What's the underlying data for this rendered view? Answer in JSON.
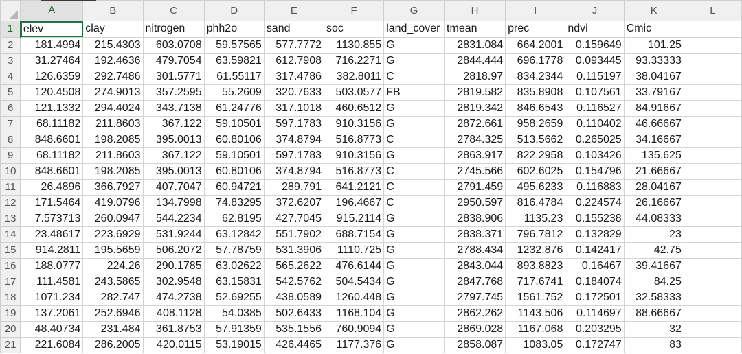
{
  "columns": [
    "A",
    "B",
    "C",
    "D",
    "E",
    "F",
    "G",
    "H",
    "I",
    "J",
    "K",
    "L"
  ],
  "rows": [
    {
      "n": "1",
      "cells": [
        "elev",
        "clay",
        "nitrogen",
        "phh2o",
        "sand",
        "soc",
        "land_cover",
        "tmean",
        "prec",
        "ndvi",
        "Cmic",
        ""
      ]
    },
    {
      "n": "2",
      "cells": [
        "181.4994",
        "215.4303",
        "603.0708",
        "59.57565",
        "577.7772",
        "1130.855",
        "G",
        "2831.084",
        "664.2001",
        "0.159649",
        "101.25",
        ""
      ]
    },
    {
      "n": "3",
      "cells": [
        "31.27464",
        "192.4636",
        "479.7054",
        "63.59821",
        "612.7908",
        "716.2271",
        "G",
        "2844.444",
        "696.1778",
        "0.093445",
        "93.33333",
        ""
      ]
    },
    {
      "n": "4",
      "cells": [
        "126.6359",
        "292.7486",
        "301.5771",
        "61.55117",
        "317.4786",
        "382.8011",
        "C",
        "2818.97",
        "834.2344",
        "0.115197",
        "38.04167",
        ""
      ]
    },
    {
      "n": "5",
      "cells": [
        "120.4508",
        "274.9013",
        "357.2595",
        "55.2609",
        "320.7633",
        "503.0577",
        "FB",
        "2819.582",
        "835.8908",
        "0.107561",
        "33.79167",
        ""
      ]
    },
    {
      "n": "6",
      "cells": [
        "121.1332",
        "294.4024",
        "343.7138",
        "61.24776",
        "317.1018",
        "460.6512",
        "G",
        "2819.342",
        "846.6543",
        "0.116527",
        "84.91667",
        ""
      ]
    },
    {
      "n": "7",
      "cells": [
        "68.11182",
        "211.8603",
        "367.122",
        "59.10501",
        "597.1783",
        "910.3156",
        "G",
        "2872.661",
        "958.2659",
        "0.110402",
        "46.66667",
        ""
      ]
    },
    {
      "n": "8",
      "cells": [
        "848.6601",
        "198.2085",
        "395.0013",
        "60.80106",
        "374.8794",
        "516.8773",
        "C",
        "2784.325",
        "513.5662",
        "0.265025",
        "34.16667",
        ""
      ]
    },
    {
      "n": "9",
      "cells": [
        "68.11182",
        "211.8603",
        "367.122",
        "59.10501",
        "597.1783",
        "910.3156",
        "G",
        "2863.917",
        "822.2958",
        "0.103426",
        "135.625",
        ""
      ]
    },
    {
      "n": "10",
      "cells": [
        "848.6601",
        "198.2085",
        "395.0013",
        "60.80106",
        "374.8794",
        "516.8773",
        "C",
        "2745.566",
        "602.6025",
        "0.154796",
        "21.66667",
        ""
      ]
    },
    {
      "n": "11",
      "cells": [
        "26.4896",
        "366.7927",
        "407.7047",
        "60.94721",
        "289.791",
        "641.2121",
        "C",
        "2791.459",
        "495.6233",
        "0.116883",
        "28.04167",
        ""
      ]
    },
    {
      "n": "12",
      "cells": [
        "171.5464",
        "419.0796",
        "134.7998",
        "74.83295",
        "372.6207",
        "196.4667",
        "C",
        "2950.597",
        "816.4784",
        "0.224574",
        "26.16667",
        ""
      ]
    },
    {
      "n": "13",
      "cells": [
        "7.573713",
        "260.0947",
        "544.2234",
        "62.8195",
        "427.7045",
        "915.2114",
        "G",
        "2838.906",
        "1135.23",
        "0.155238",
        "44.08333",
        ""
      ]
    },
    {
      "n": "14",
      "cells": [
        "23.48617",
        "223.6929",
        "531.9244",
        "63.12842",
        "551.7902",
        "688.7154",
        "G",
        "2838.371",
        "796.7812",
        "0.132829",
        "23",
        ""
      ]
    },
    {
      "n": "15",
      "cells": [
        "914.2811",
        "195.5659",
        "506.2072",
        "57.78759",
        "531.3906",
        "1110.725",
        "G",
        "2788.434",
        "1232.876",
        "0.142417",
        "42.75",
        ""
      ]
    },
    {
      "n": "16",
      "cells": [
        "188.0777",
        "224.26",
        "290.1785",
        "63.02622",
        "565.2622",
        "476.6144",
        "G",
        "2843.044",
        "893.8823",
        "0.16467",
        "39.41667",
        ""
      ]
    },
    {
      "n": "17",
      "cells": [
        "111.4581",
        "243.5865",
        "302.9548",
        "63.15831",
        "542.5762",
        "504.5434",
        "G",
        "2847.768",
        "717.6741",
        "0.184074",
        "84.25",
        ""
      ]
    },
    {
      "n": "18",
      "cells": [
        "1071.234",
        "282.747",
        "474.2738",
        "52.69255",
        "438.0589",
        "1260.448",
        "G",
        "2797.745",
        "1561.752",
        "0.172501",
        "32.58333",
        ""
      ]
    },
    {
      "n": "19",
      "cells": [
        "137.2061",
        "252.6946",
        "408.1128",
        "54.0385",
        "502.6433",
        "1168.104",
        "G",
        "2862.262",
        "1143.506",
        "0.114697",
        "88.66667",
        ""
      ]
    },
    {
      "n": "20",
      "cells": [
        "48.40734",
        "231.484",
        "361.8753",
        "57.91359",
        "535.1556",
        "760.9094",
        "G",
        "2869.028",
        "1167.068",
        "0.203295",
        "32",
        ""
      ]
    },
    {
      "n": "21",
      "cells": [
        "221.6084",
        "286.2005",
        "420.0115",
        "53.19015",
        "426.4465",
        "1177.376",
        "G",
        "2858.087",
        "1083.05",
        "0.172747",
        "83",
        ""
      ]
    }
  ]
}
